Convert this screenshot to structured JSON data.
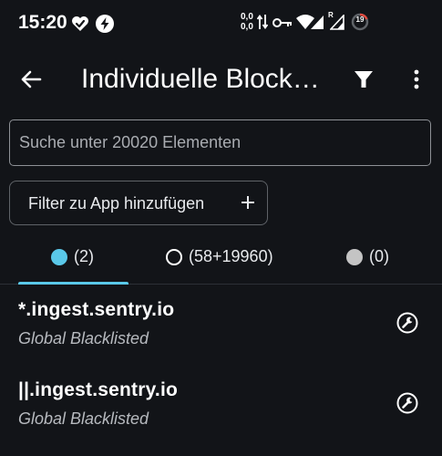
{
  "status_bar": {
    "time": "15:20",
    "net_speed_up": "0,0",
    "net_speed_down": "0,0",
    "roaming_label": "R",
    "battery_level": "19",
    "icons": [
      "heart-check-icon",
      "lightning-bolt-icon",
      "data-arrows-icon",
      "vpn-key-icon",
      "wifi-icon",
      "signal-icon",
      "signal-roaming-icon",
      "battery-icon"
    ]
  },
  "app_bar": {
    "title": "Individuelle Blocklisten",
    "back_icon": "arrow-back-icon",
    "filter_icon": "filter-icon",
    "menu_icon": "more-vert-icon"
  },
  "search": {
    "value": "",
    "placeholder": "Suche unter 20020 Elementen"
  },
  "add_filter": {
    "label": "Filter zu App hinzufügen",
    "icon": "plus-icon"
  },
  "tabs": [
    {
      "label": "(2)",
      "dot_style": "filled",
      "dot_color": "#5ac8e8",
      "active": true
    },
    {
      "label": "(58+19960)",
      "dot_style": "outline",
      "dot_color": "#ffffff",
      "active": false
    },
    {
      "label": "(0)",
      "dot_style": "filled",
      "dot_color": "#c4c4c4",
      "active": false
    }
  ],
  "items": [
    {
      "title": "*.ingest.sentry.io",
      "subtitle": "Global Blacklisted",
      "action_icon": "wrench-icon"
    },
    {
      "title": "||.ingest.sentry.io",
      "subtitle": "Global Blacklisted",
      "action_icon": "wrench-icon"
    }
  ],
  "colors": {
    "background": "#121418",
    "accent": "#5ac8e8",
    "text_primary": "#ffffff",
    "text_secondary": "#b7babf",
    "outline": "#8e9196"
  }
}
